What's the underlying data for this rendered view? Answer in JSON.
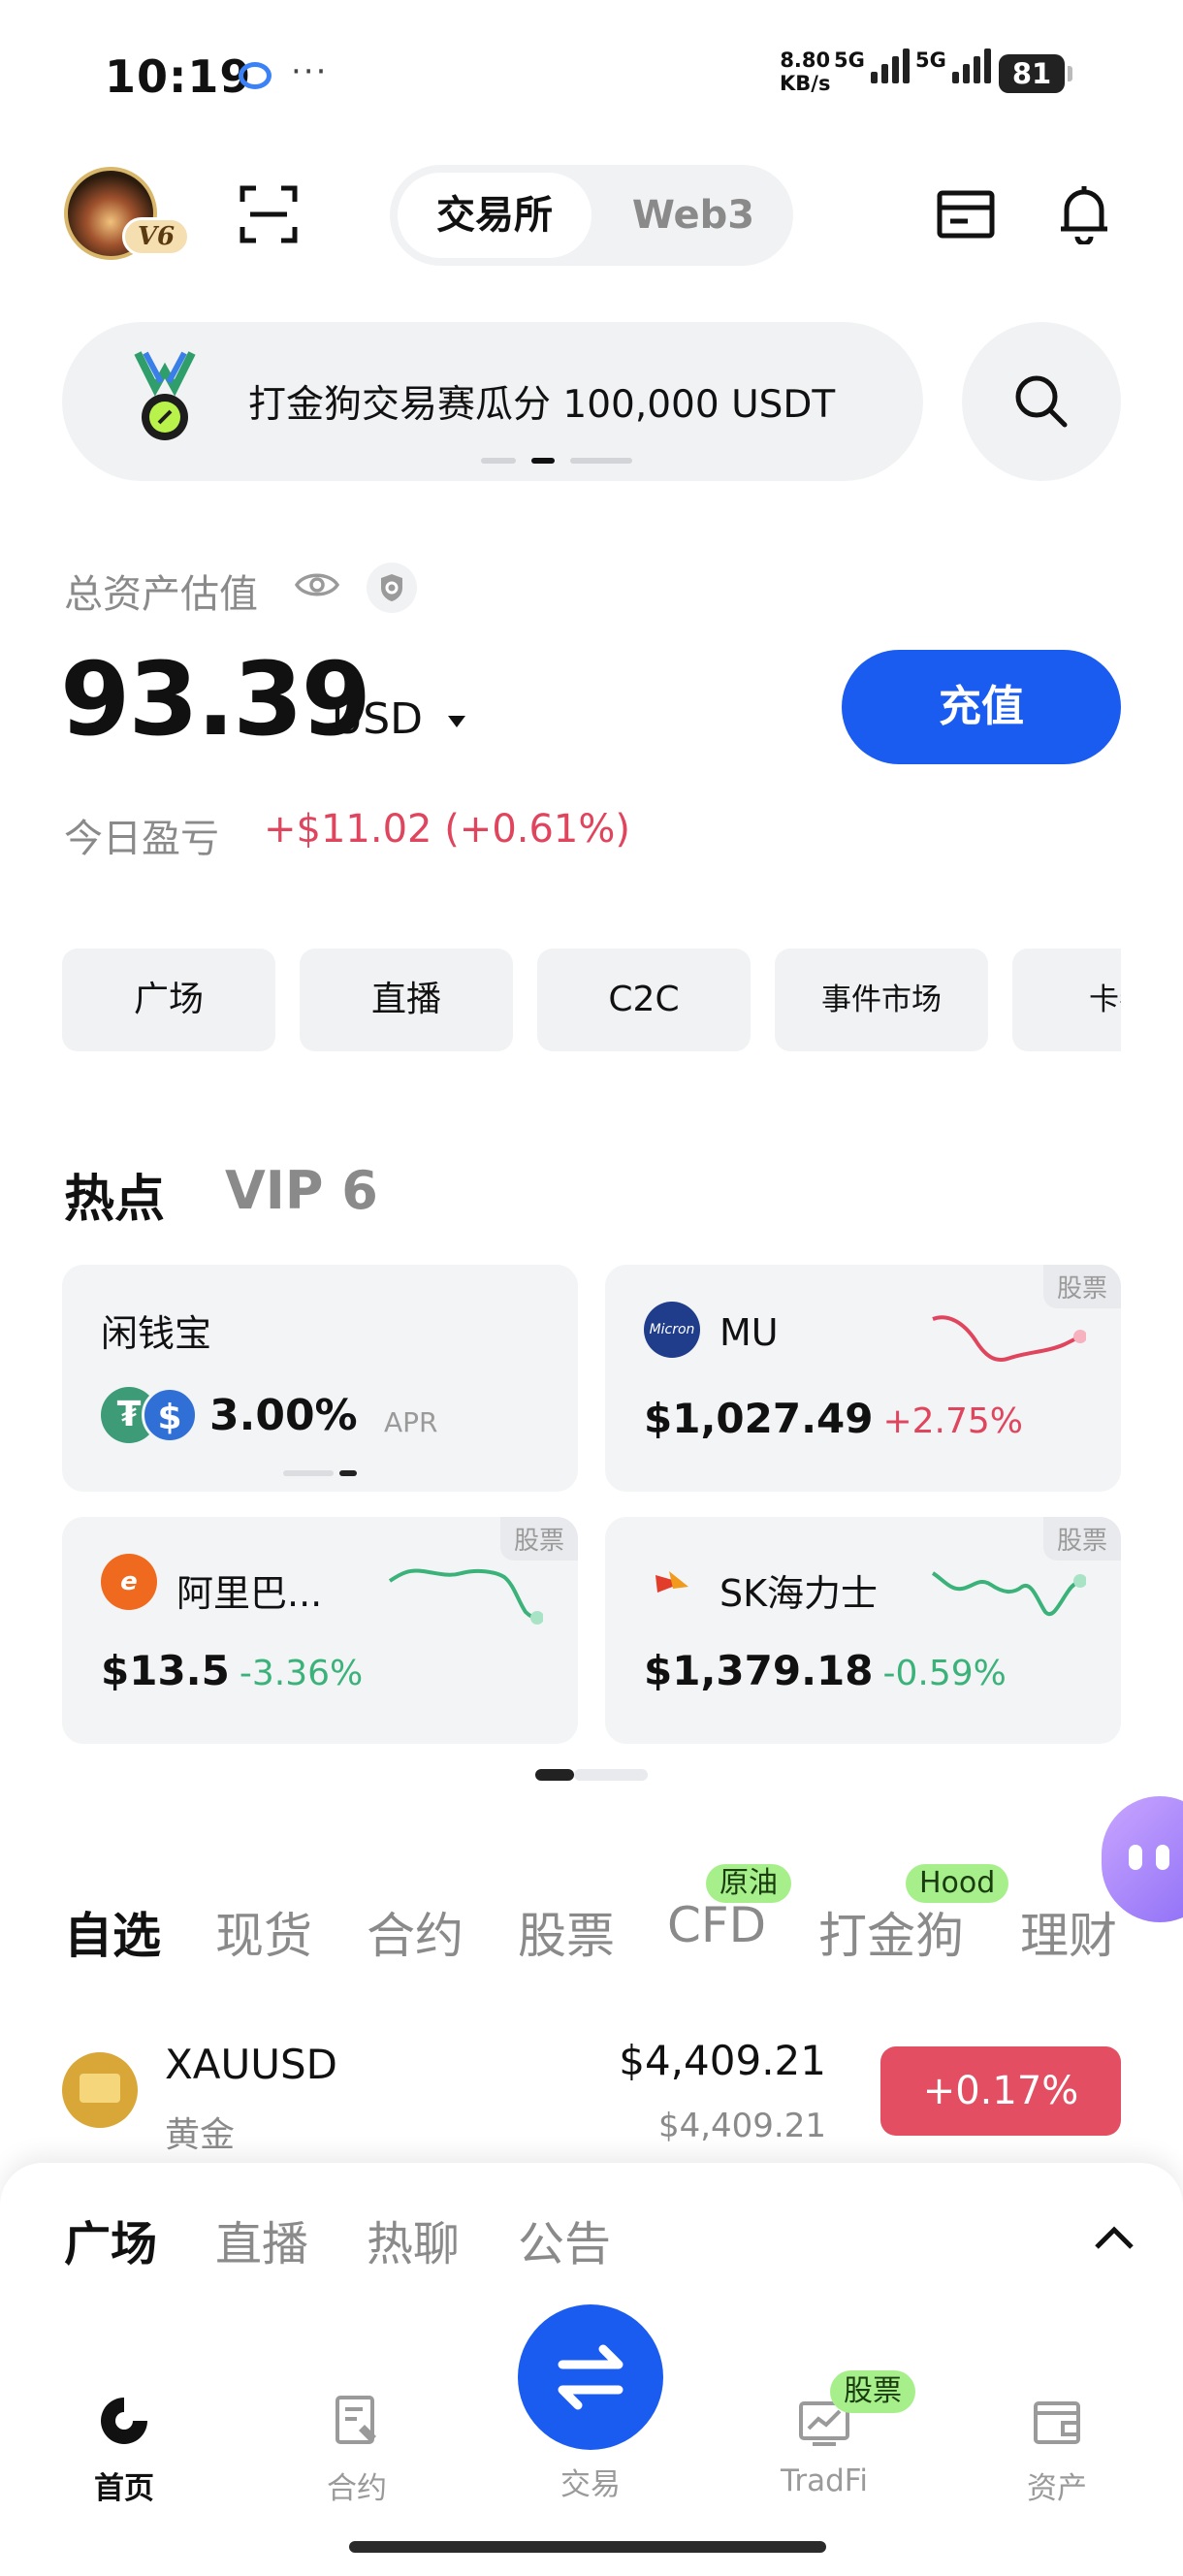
{
  "status_bar": {
    "time": "10:19",
    "net_speed_value": "8.80",
    "net_speed_unit": "KB/s",
    "sim1": "5G",
    "sim2": "5G",
    "battery": "81"
  },
  "header": {
    "vip_badge": "V6",
    "segment": {
      "exchange": "交易所",
      "web3": "Web3",
      "selected": "交易所"
    }
  },
  "banner": {
    "text": "打金狗交易赛瓜分 100,000 USDT"
  },
  "assets": {
    "title": "总资产估值",
    "balance": "93.39",
    "currency": "USD",
    "deposit_label": "充值",
    "pnl_label": "今日盈亏",
    "pnl_value": "+$11.02 (+0.61%)"
  },
  "quick_links": [
    "广场",
    "直播",
    "C2C",
    "事件市场",
    "卡券"
  ],
  "hot": {
    "tab_hot": "热点",
    "tab_vip": "VIP 6",
    "savings": {
      "name": "闲钱宝",
      "apr": "3.00%",
      "apr_label": "APR"
    },
    "cards": [
      {
        "tag": "股票",
        "name": "MU",
        "price": "$1,027.49",
        "change": "+2.75%"
      },
      {
        "tag": "股票",
        "name": "阿里巴...",
        "price": "$13.5",
        "change": "-3.36%"
      },
      {
        "tag": "股票",
        "name": "SK海力士",
        "price": "$1,379.18",
        "change": "-0.59%"
      }
    ]
  },
  "watch_tabs": {
    "items": [
      "自选",
      "现货",
      "合约",
      "股票",
      "CFD",
      "打金狗",
      "理财"
    ],
    "badge_cfd": "原油",
    "badge_dog": "Hood"
  },
  "watchlist": [
    {
      "symbol": "XAUUSD",
      "name": "黄金",
      "price": "$4,409.21",
      "price_sub": "$4,409.21",
      "change": "+0.17%"
    }
  ],
  "sheet": {
    "tabs": [
      "广场",
      "直播",
      "热聊",
      "公告"
    ]
  },
  "bottom_nav": {
    "home": "首页",
    "futures": "合约",
    "trade": "交易",
    "tradfi": "TradFi",
    "tradfi_badge": "股票",
    "assets": "资产"
  },
  "colors": {
    "brand_blue": "#1b5cf0",
    "up_red": "#e0455e",
    "down_green": "#3bb27a",
    "badge_green": "#a7ef8b"
  },
  "icons": [
    "scan-icon",
    "card-icon",
    "bell-icon",
    "medal-icon",
    "search-icon",
    "eye-icon",
    "shield-icon",
    "tether-icon",
    "usdc-icon",
    "micron-logo",
    "alibaba-logo",
    "skhynix-logo",
    "gold-icon",
    "chevron-up-icon",
    "home-icon",
    "futures-icon",
    "swap-icon",
    "tradfi-icon",
    "wallet-icon",
    "ai-assistant-icon"
  ]
}
